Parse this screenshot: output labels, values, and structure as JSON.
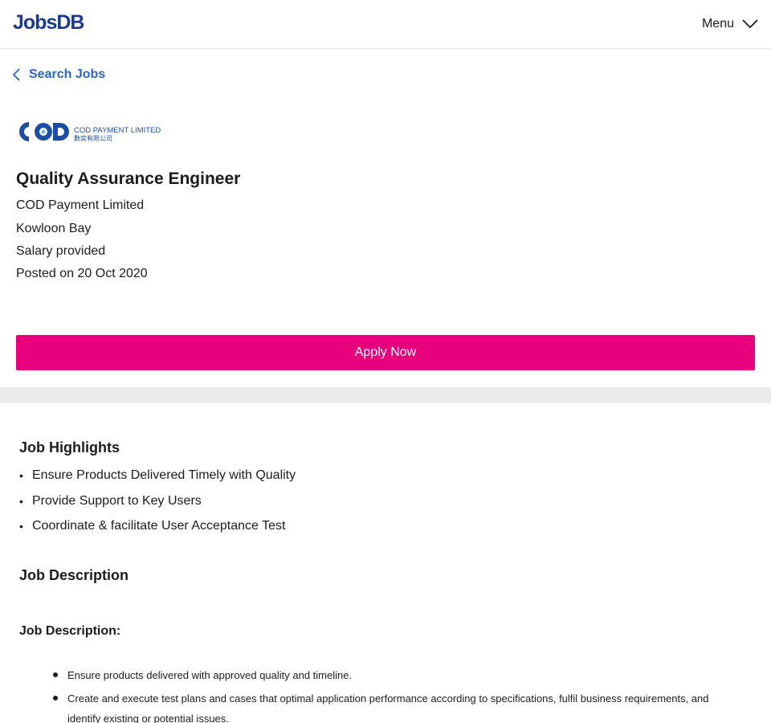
{
  "header": {
    "logo_text": "JobsDB",
    "menu_label": "Menu",
    "menu_icon": "chevron-down-icon",
    "brand_color": "#1a3a8f"
  },
  "nav": {
    "back_label": "Search Jobs",
    "back_icon": "chevron-left-icon",
    "link_color": "#2765cf"
  },
  "company_logo": {
    "text_main": "COD PAYMENT LIMITED",
    "text_sub": "數奕有限公司",
    "letters": "COD"
  },
  "job": {
    "title": "Quality Assurance Engineer",
    "company": "COD Payment Limited",
    "location": "Kowloon Bay",
    "salary": "Salary provided",
    "posted": "Posted on 20 Oct 2020"
  },
  "apply": {
    "label": "Apply Now",
    "color": "#e8007d"
  },
  "highlights": {
    "heading": "Job Highlights",
    "bullet": "•",
    "items": [
      "Ensure Products Delivered Timely with Quality",
      "Provide Support to Key Users",
      "Coordinate & facilitate User Acceptance Test"
    ]
  },
  "description": {
    "heading": "Job Description",
    "subheading": "Job Description:",
    "items": [
      "Ensure products delivered with approved quality and timeline.",
      "Create and execute test plans and cases that optimal application performance according to specifications, fulfil business requirements, and identify existing or potential issues."
    ]
  }
}
